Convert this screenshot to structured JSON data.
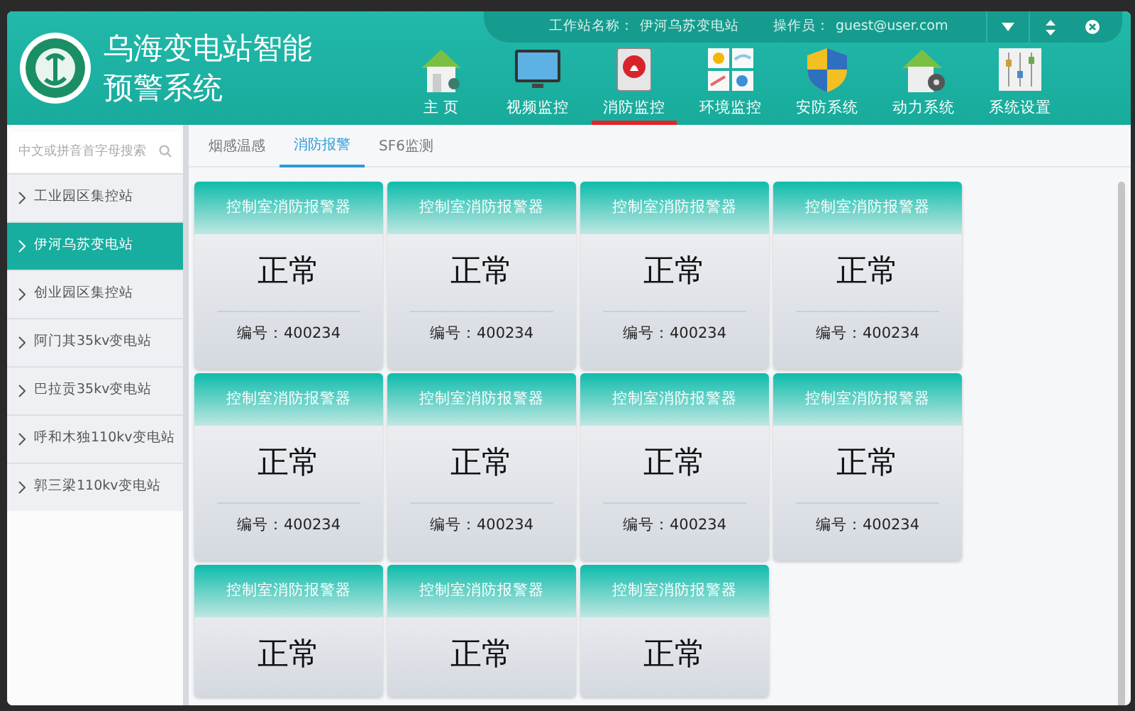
{
  "app": {
    "title_lines": [
      "乌海变电站智能",
      "预警系统"
    ]
  },
  "info_bar": {
    "station_label": "工作站名称：",
    "station": "伊河乌苏变电站",
    "operator_label": "操作员：",
    "operator": "guest@user.com"
  },
  "nav": [
    {
      "label": "主 页",
      "kind": "home",
      "selected": false
    },
    {
      "label": "视频监控",
      "kind": "video",
      "selected": false
    },
    {
      "label": "消防监控",
      "kind": "fire",
      "selected": true
    },
    {
      "label": "环境监控",
      "kind": "environment",
      "selected": false
    },
    {
      "label": "安防系统",
      "kind": "security",
      "selected": false
    },
    {
      "label": "动力系统",
      "kind": "power",
      "selected": false
    },
    {
      "label": "系统设置",
      "kind": "settings",
      "selected": false
    }
  ],
  "search": {
    "placeholder": "中文或拼音首字母搜索"
  },
  "stations": [
    {
      "label": "工业园区集控站",
      "selected": false
    },
    {
      "label": "伊河乌苏变电站",
      "selected": true
    },
    {
      "label": "创业园区集控站",
      "selected": false
    },
    {
      "label": "阿门其35kv变电站",
      "selected": false
    },
    {
      "label": "巴拉贡35kv变电站",
      "selected": false
    },
    {
      "label": "呼和木独110kv变电站",
      "selected": false
    },
    {
      "label": "郭三梁110kv变电站",
      "selected": false
    }
  ],
  "tabs": [
    {
      "label": "烟感温感",
      "selected": false
    },
    {
      "label": "消防报警",
      "selected": true
    },
    {
      "label": "SF6监测",
      "selected": false
    }
  ],
  "sensors": [
    {
      "name": "控制室消防报警器",
      "status": "正常",
      "id_label": "编号：",
      "id": "400234"
    },
    {
      "name": "控制室消防报警器",
      "status": "正常",
      "id_label": "编号：",
      "id": "400234"
    },
    {
      "name": "控制室消防报警器",
      "status": "正常",
      "id_label": "编号：",
      "id": "400234"
    },
    {
      "name": "控制室消防报警器",
      "status": "正常",
      "id_label": "编号：",
      "id": "400234"
    },
    {
      "name": "控制室消防报警器",
      "status": "正常",
      "id_label": "编号：",
      "id": "400234"
    },
    {
      "name": "控制室消防报警器",
      "status": "正常",
      "id_label": "编号：",
      "id": "400234"
    },
    {
      "name": "控制室消防报警器",
      "status": "正常",
      "id_label": "编号：",
      "id": "400234"
    },
    {
      "name": "控制室消防报警器",
      "status": "正常",
      "id_label": "编号：",
      "id": "400234"
    },
    {
      "name": "控制室消防报警器",
      "status": "正常"
    },
    {
      "name": "控制室消防报警器",
      "status": "正常"
    },
    {
      "name": "控制室消防报警器",
      "status": "正常"
    }
  ]
}
